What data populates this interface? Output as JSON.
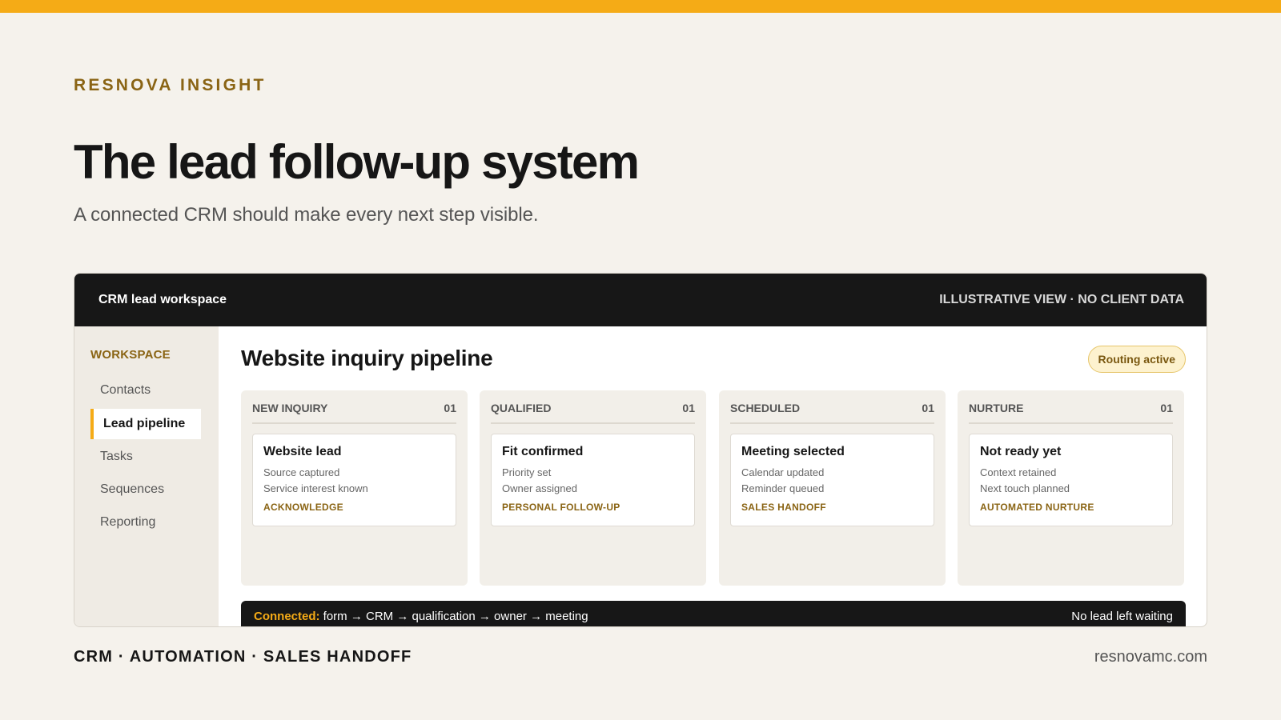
{
  "brand": {
    "eyebrow": "RESNOVA INSIGHT",
    "accent": "#f5ab16"
  },
  "hero": {
    "title": "The lead follow-up system",
    "subtitle": "A connected CRM should make every next step visible."
  },
  "window": {
    "title": "CRM lead workspace",
    "note": "ILLUSTRATIVE VIEW · NO CLIENT DATA"
  },
  "sidebar": {
    "heading": "WORKSPACE",
    "items": [
      {
        "label": "Contacts",
        "active": false
      },
      {
        "label": "Lead pipeline",
        "active": true
      },
      {
        "label": "Tasks",
        "active": false
      },
      {
        "label": "Sequences",
        "active": false
      },
      {
        "label": "Reporting",
        "active": false
      }
    ]
  },
  "main": {
    "title": "Website inquiry pipeline",
    "status": "Routing active",
    "columns": [
      {
        "name": "NEW INQUIRY",
        "count": "01",
        "card": {
          "title": "Website lead",
          "lines": [
            "Source captured",
            "Service interest known"
          ],
          "tag": "ACKNOWLEDGE"
        }
      },
      {
        "name": "QUALIFIED",
        "count": "01",
        "card": {
          "title": "Fit confirmed",
          "lines": [
            "Priority set",
            "Owner assigned"
          ],
          "tag": "PERSONAL FOLLOW-UP"
        }
      },
      {
        "name": "SCHEDULED",
        "count": "01",
        "card": {
          "title": "Meeting selected",
          "lines": [
            "Calendar updated",
            "Reminder queued"
          ],
          "tag": "SALES HANDOFF"
        }
      },
      {
        "name": "NURTURE",
        "count": "01",
        "card": {
          "title": "Not ready yet",
          "lines": [
            "Context retained",
            "Next touch planned"
          ],
          "tag": "AUTOMATED NURTURE"
        }
      }
    ]
  },
  "flow": {
    "label": "Connected:",
    "path": "form → CRM → qualification → owner → meeting",
    "note": "No lead left waiting"
  },
  "footer": {
    "tagline": "CRM · AUTOMATION · SALES HANDOFF",
    "site": "resnovamc.com"
  }
}
